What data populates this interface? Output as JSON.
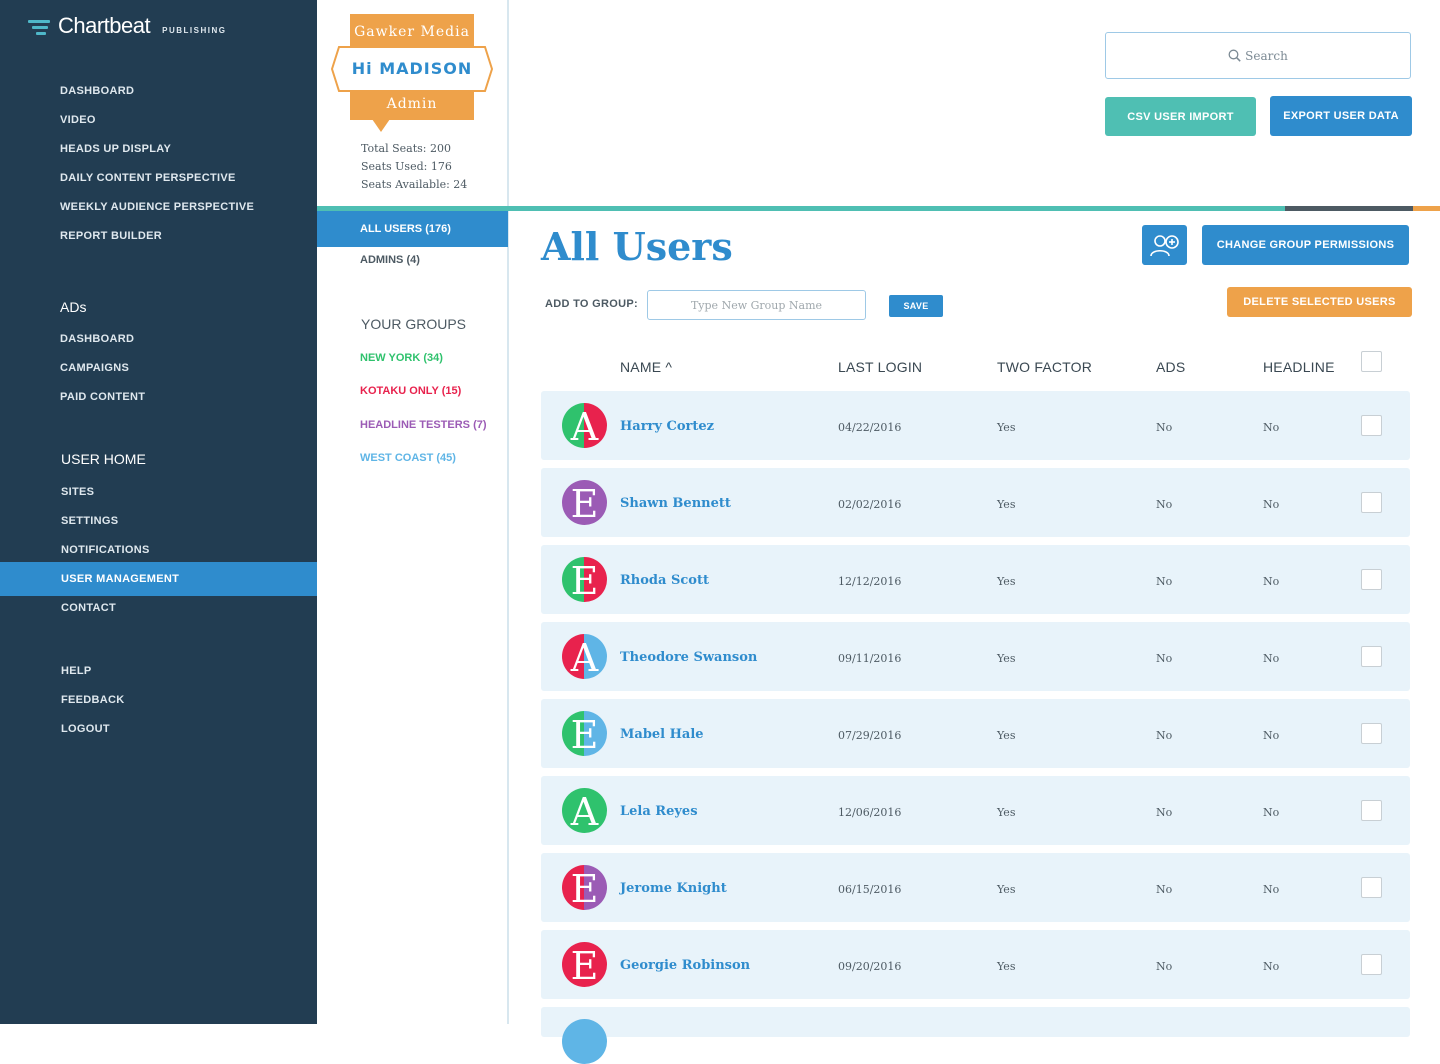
{
  "brand": {
    "name": "Chartbeat",
    "sub": "PUBLISHING"
  },
  "nav": {
    "publishing": [
      "DASHBOARD",
      "VIDEO",
      "HEADS UP DISPLAY",
      "DAILY CONTENT PERSPECTIVE",
      "WEEKLY AUDIENCE PERSPECTIVE",
      "REPORT BUILDER"
    ],
    "ads_title": "ADs",
    "ads": [
      "DASHBOARD",
      "CAMPAIGNS",
      "PAID CONTENT"
    ],
    "user_home_title": "USER HOME",
    "user_home": [
      "SITES",
      "SETTINGS",
      "NOTIFICATIONS",
      "USER MANAGEMENT",
      "CONTACT"
    ],
    "footer": [
      "HELP",
      "FEEDBACK",
      "LOGOUT"
    ]
  },
  "account": {
    "org": "Gawker Media",
    "greeting": "Hi MADISON",
    "role": "Admin",
    "total_seats": "Total Seats: 200",
    "seats_used": "Seats Used: 176",
    "seats_available": "Seats Available: 24"
  },
  "filters": {
    "all_users": "ALL USERS (176)",
    "admins": "ADMINS (4)",
    "groups_title": "YOUR GROUPS",
    "groups": [
      {
        "label": "NEW YORK (34)",
        "color": "#2fc26d"
      },
      {
        "label": "KOTAKU ONLY (15)",
        "color": "#e8224d"
      },
      {
        "label": "HEADLINE TESTERS (7)",
        "color": "#9b5bb5"
      },
      {
        "label": "WEST COAST (45)",
        "color": "#5fb5e6"
      }
    ]
  },
  "toolbar": {
    "search_placeholder": "Search",
    "csv_import": "CSV USER IMPORT",
    "export": "EXPORT USER DATA",
    "change_permissions": "CHANGE GROUP PERMISSIONS",
    "delete_selected": "DELETE SELECTED USERS",
    "add_to_group_label": "ADD TO GROUP:",
    "group_name_placeholder": "Type New Group Name",
    "save": "SAVE"
  },
  "page": {
    "title": "All Users"
  },
  "table": {
    "headers": {
      "name": "NAME ^",
      "last_login": "LAST LOGIN",
      "two_factor": "TWO FACTOR",
      "ads": "ADS",
      "headline": "HEADLINE"
    },
    "rows": [
      {
        "letter": "A",
        "name": "Harry Cortez",
        "last_login": "04/22/2016",
        "two_factor": "Yes",
        "ads": "No",
        "headline": "No",
        "colors": [
          "#2fc26d",
          "#e8224d"
        ]
      },
      {
        "letter": "E",
        "name": "Shawn Bennett",
        "last_login": "02/02/2016",
        "two_factor": "Yes",
        "ads": "No",
        "headline": "No",
        "colors": [
          "#9b5bb5"
        ]
      },
      {
        "letter": "E",
        "name": "Rhoda Scott",
        "last_login": "12/12/2016",
        "two_factor": "Yes",
        "ads": "No",
        "headline": "No",
        "colors": [
          "#2fc26d",
          "#e8224d"
        ]
      },
      {
        "letter": "A",
        "name": "Theodore Swanson",
        "last_login": "09/11/2016",
        "two_factor": "Yes",
        "ads": "No",
        "headline": "No",
        "colors": [
          "#e8224d",
          "#5fb5e6"
        ]
      },
      {
        "letter": "E",
        "name": "Mabel Hale",
        "last_login": "07/29/2016",
        "two_factor": "Yes",
        "ads": "No",
        "headline": "No",
        "colors": [
          "#2fc26d",
          "#5fb5e6"
        ]
      },
      {
        "letter": "A",
        "name": "Lela Reyes",
        "last_login": "12/06/2016",
        "two_factor": "Yes",
        "ads": "No",
        "headline": "No",
        "colors": [
          "#2fc26d"
        ]
      },
      {
        "letter": "E",
        "name": "Jerome Knight",
        "last_login": "06/15/2016",
        "two_factor": "Yes",
        "ads": "No",
        "headline": "No",
        "colors": [
          "#e8224d",
          "#9b5bb5"
        ]
      },
      {
        "letter": "E",
        "name": "Georgie Robinson",
        "last_login": "09/20/2016",
        "two_factor": "Yes",
        "ads": "No",
        "headline": "No",
        "colors": [
          "#e8224d"
        ]
      }
    ]
  },
  "colors": {
    "nav_bg": "#223d52",
    "accent_blue": "#2f8ccd",
    "teal": "#4fbfb3",
    "orange": "#eea24a",
    "row_bg": "#e8f3fa"
  }
}
